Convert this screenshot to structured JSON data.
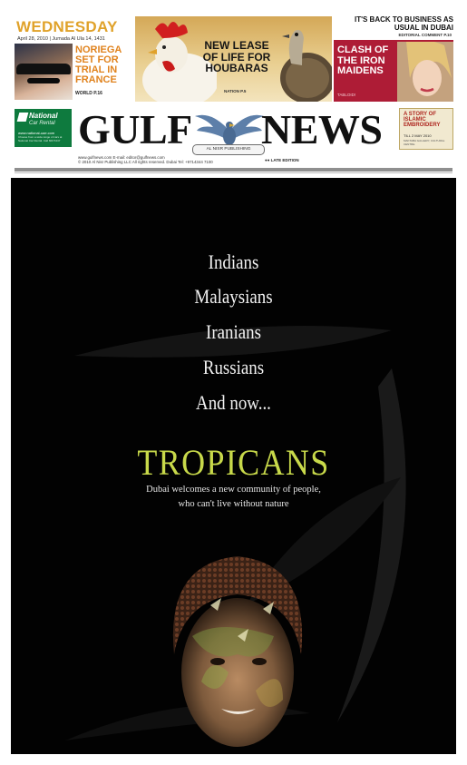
{
  "masthead": {
    "day": "WEDNESDAY",
    "date": "April 28, 2010  |  Jumada Al Ula 14, 1431",
    "teasers": [
      {
        "headline": "NORIEGA SET FOR TRIAL IN FRANCE",
        "section": "WORLD P.16"
      },
      {
        "headline": "NEW LEASE OF LIFE FOR HOUBARAS",
        "section": "NATION P.5"
      },
      {
        "headline": "CLASH OF THE IRON MAIDENS",
        "section": "TABLOID!"
      }
    ],
    "top_right": {
      "headline": "IT'S BACK TO BUSINESS AS USUAL IN DUBAI",
      "section": "EDITORIAL COMMENT P.10"
    },
    "logo_left": "GULF",
    "logo_right": "NEWS",
    "publisher_badge": "AL NISR PUBLISHING",
    "contact_line1": "www.gulfnews.com E-mail: editor@gulfnews.com",
    "contact_line2": "© 2010 Al Nisr Publishing LLC All rights reserved. Dubai Tel: +9714344 7100",
    "edition": "●● LATE EDITION",
    "left_ad": {
      "title": "National",
      "subtitle": "Car Rental",
      "url": "www.national-uae.com",
      "desc": "Choose from a wide range of cars at National Car Rental. Call 600 5447"
    },
    "right_ad": {
      "title": "A STORY OF ISLAMIC EMBROIDERY",
      "date": "TILL 2 MAY 2010",
      "venue": "MAKTABA GALLERY, CULTURAL CENTRE"
    }
  },
  "advert": {
    "lines": [
      "Indians",
      "Malaysians",
      "Iranians",
      "Russians",
      "And now..."
    ],
    "headline": "TROPICANS",
    "tagline1": "Dubai welcomes a new community of people,",
    "tagline2": "who can't live without nature"
  },
  "colors": {
    "ad_background": "#020202",
    "headline_green": "#c8d94a",
    "masthead_orange": "#e0a22a",
    "maidens_red": "#ae1c36"
  }
}
